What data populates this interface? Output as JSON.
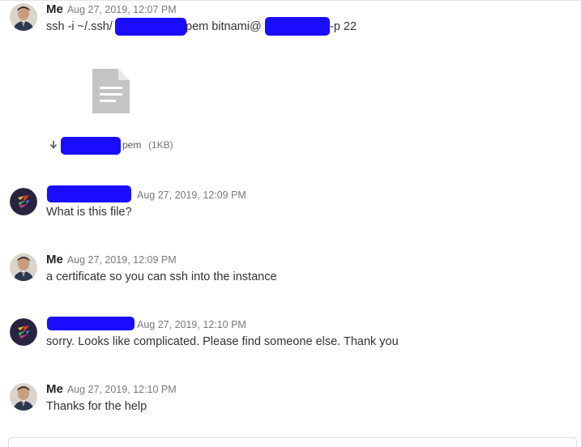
{
  "messages": [
    {
      "sender": "Me",
      "timestamp": "Aug 27, 2019, 12:07 PM",
      "text_parts": [
        "ssh -i ~/.ssh/",
        "pem bitnami@",
        "-p 22"
      ],
      "attachment": {
        "name_suffix": "pem",
        "size": "(1KB)",
        "icon": "document-icon"
      },
      "avatar": "user-avatar-photo"
    },
    {
      "sender": "",
      "timestamp": "Aug 27, 2019, 12:09 PM",
      "text": "What is this file?",
      "avatar": "client-avatar-logo"
    },
    {
      "sender": "Me",
      "timestamp": "Aug 27, 2019, 12:09 PM",
      "text": "a certificate so you can ssh into the instance",
      "avatar": "user-avatar-photo"
    },
    {
      "sender": "",
      "timestamp": "Aug 27, 2019, 12:10 PM",
      "text": "sorry. Looks like complicated. Please find someone else. Thank you",
      "avatar": "client-avatar-logo"
    },
    {
      "sender": "Me",
      "timestamp": "Aug 27, 2019, 12:10 PM",
      "text": "Thanks for the help",
      "avatar": "user-avatar-photo"
    }
  ],
  "colors": {
    "redaction": "#1a0dff",
    "timestamp": "#7a7a7a",
    "client_avatar_bg": "#2a2340"
  }
}
